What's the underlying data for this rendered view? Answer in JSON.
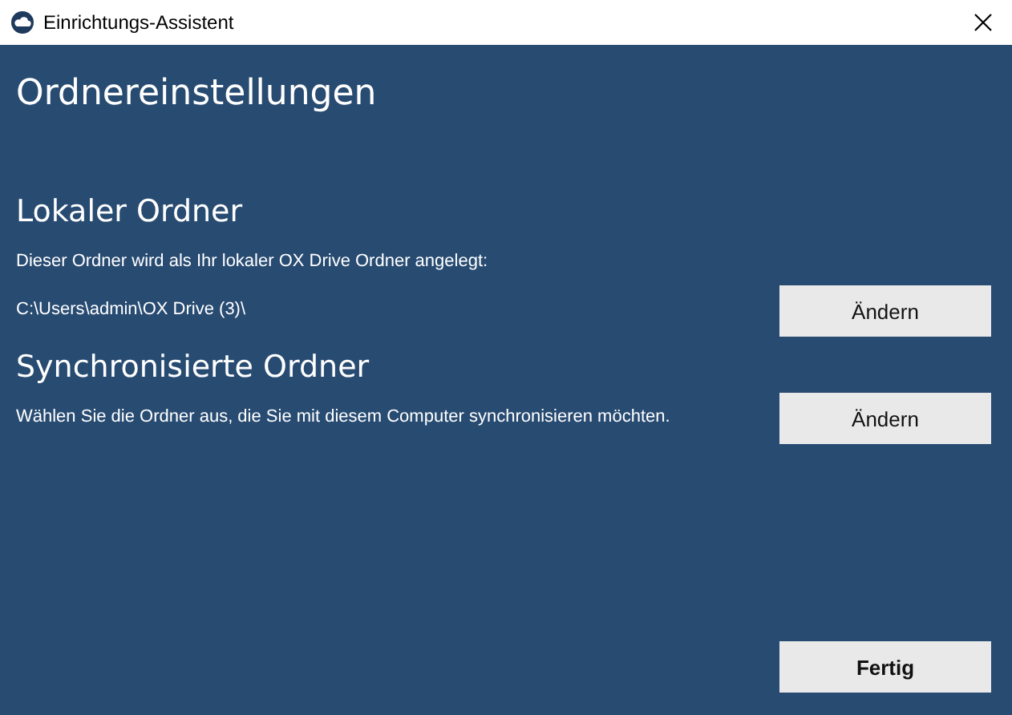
{
  "window": {
    "title": "Einrichtungs-Assistent"
  },
  "page_title": "Ordnereinstellungen",
  "sections": [
    {
      "heading": "Lokaler Ordner",
      "description": "Dieser Ordner wird als Ihr lokaler OX Drive Ordner angelegt:",
      "path": "C:\\Users\\admin\\OX Drive (3)\\",
      "button": "Ändern"
    },
    {
      "heading": "Synchronisierte Ordner",
      "description": "Wählen Sie die Ordner aus, die Sie mit diesem Computer synchronisieren möchten.",
      "button": "Ändern"
    }
  ],
  "finish_button": "Fertig"
}
